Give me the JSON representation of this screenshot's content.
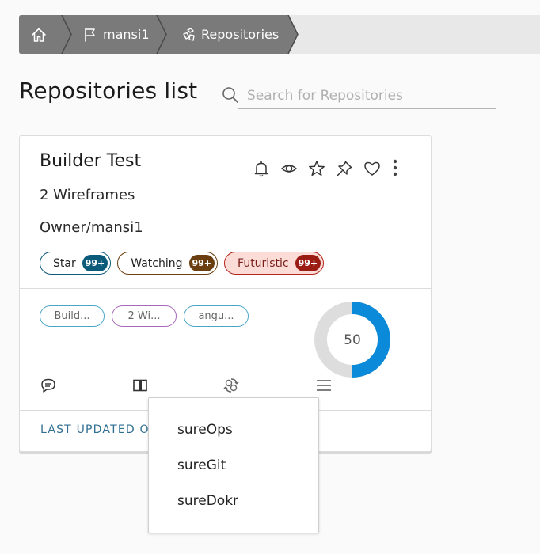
{
  "breadcrumb": {
    "items": [
      {
        "label": "",
        "icon": "home-icon"
      },
      {
        "label": "mansi1",
        "icon": "flag-icon"
      },
      {
        "label": "Repositories",
        "icon": "repository-icon"
      }
    ]
  },
  "page": {
    "title": "Repositories list",
    "search_placeholder": "Search for Repositories"
  },
  "card": {
    "title": "Builder Test",
    "subtitle": "2 Wireframes",
    "owner": "Owner/mansi1",
    "actions": [
      "bell-icon",
      "eye-icon",
      "star-icon",
      "pin-icon",
      "heart-icon",
      "more-vertical-icon"
    ],
    "badges": [
      {
        "label": "Star",
        "count": "99+",
        "color": "#0b5a7a"
      },
      {
        "label": "Watching",
        "count": "99+",
        "color": "#6b3e0f"
      },
      {
        "label": "Futuristic",
        "count": "99+",
        "color": "#b3261e"
      }
    ],
    "tags": [
      {
        "label": "Build...",
        "color": "#49a7c6"
      },
      {
        "label": "2 Wi...",
        "color": "#a669b8"
      },
      {
        "label": "angu...",
        "color": "#49a7c6"
      }
    ],
    "progress": {
      "value": 50,
      "label": "50",
      "fill_color": "#0a8ad8",
      "track_color": "#dddddd"
    },
    "bottom_icons": [
      "comment-icon",
      "columns-icon",
      "sync-icon",
      "menu-icon"
    ],
    "last_updated": "LAST UPDATED O"
  },
  "dropdown": {
    "items": [
      "sureOps",
      "sureGit",
      "sureDokr"
    ]
  }
}
